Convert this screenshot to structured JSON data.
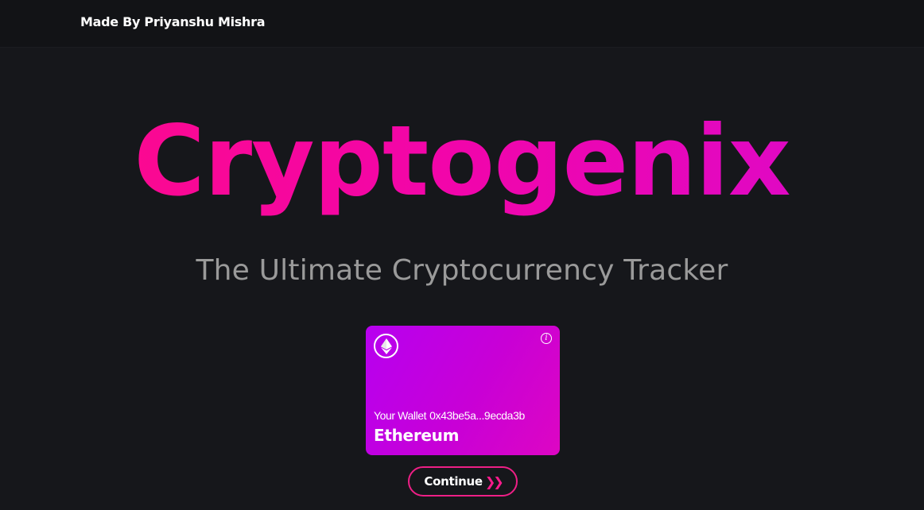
{
  "header": {
    "credit": "Made By Priyanshu Mishra"
  },
  "hero": {
    "title": "Cryptogenix",
    "subtitle": "The Ultimate Cryptocurrency Tracker"
  },
  "wallet_card": {
    "icon": "ethereum-icon",
    "info_icon": "info-icon",
    "wallet_label": "Your Wallet",
    "wallet_address": "0x43be5a...9ecda3b",
    "network": "Ethereum",
    "gradient_start": "#b700f0",
    "gradient_end": "#dd06c3"
  },
  "actions": {
    "continue_label": "Continue",
    "continue_icon": "double-chevron-right-icon",
    "accent": "#ee1f86"
  },
  "colors": {
    "background": "#16171b",
    "title_gradient_start": "#ff0a87",
    "title_gradient_end": "#d90acd",
    "subtitle": "#9a9a9a"
  }
}
